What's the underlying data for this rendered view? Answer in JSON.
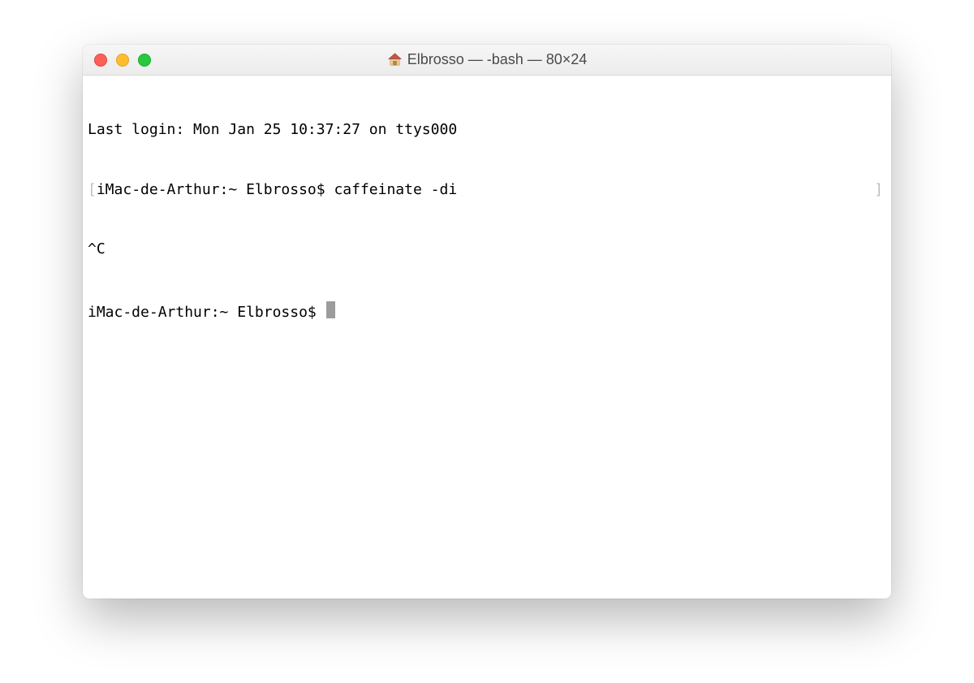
{
  "window": {
    "title": "Elbrosso — -bash — 80×24"
  },
  "terminal": {
    "lines": {
      "last_login": "Last login: Mon Jan 25 10:37:27 on ttys000",
      "prompt1_left_bracket": "[",
      "prompt1_host": "iMac-de-Arthur:~ Elbrosso$ ",
      "prompt1_command": "caffeinate -di",
      "prompt1_right_bracket": "]",
      "interrupt": "^C",
      "prompt2_host": "iMac-de-Arthur:~ Elbrosso$ "
    }
  }
}
